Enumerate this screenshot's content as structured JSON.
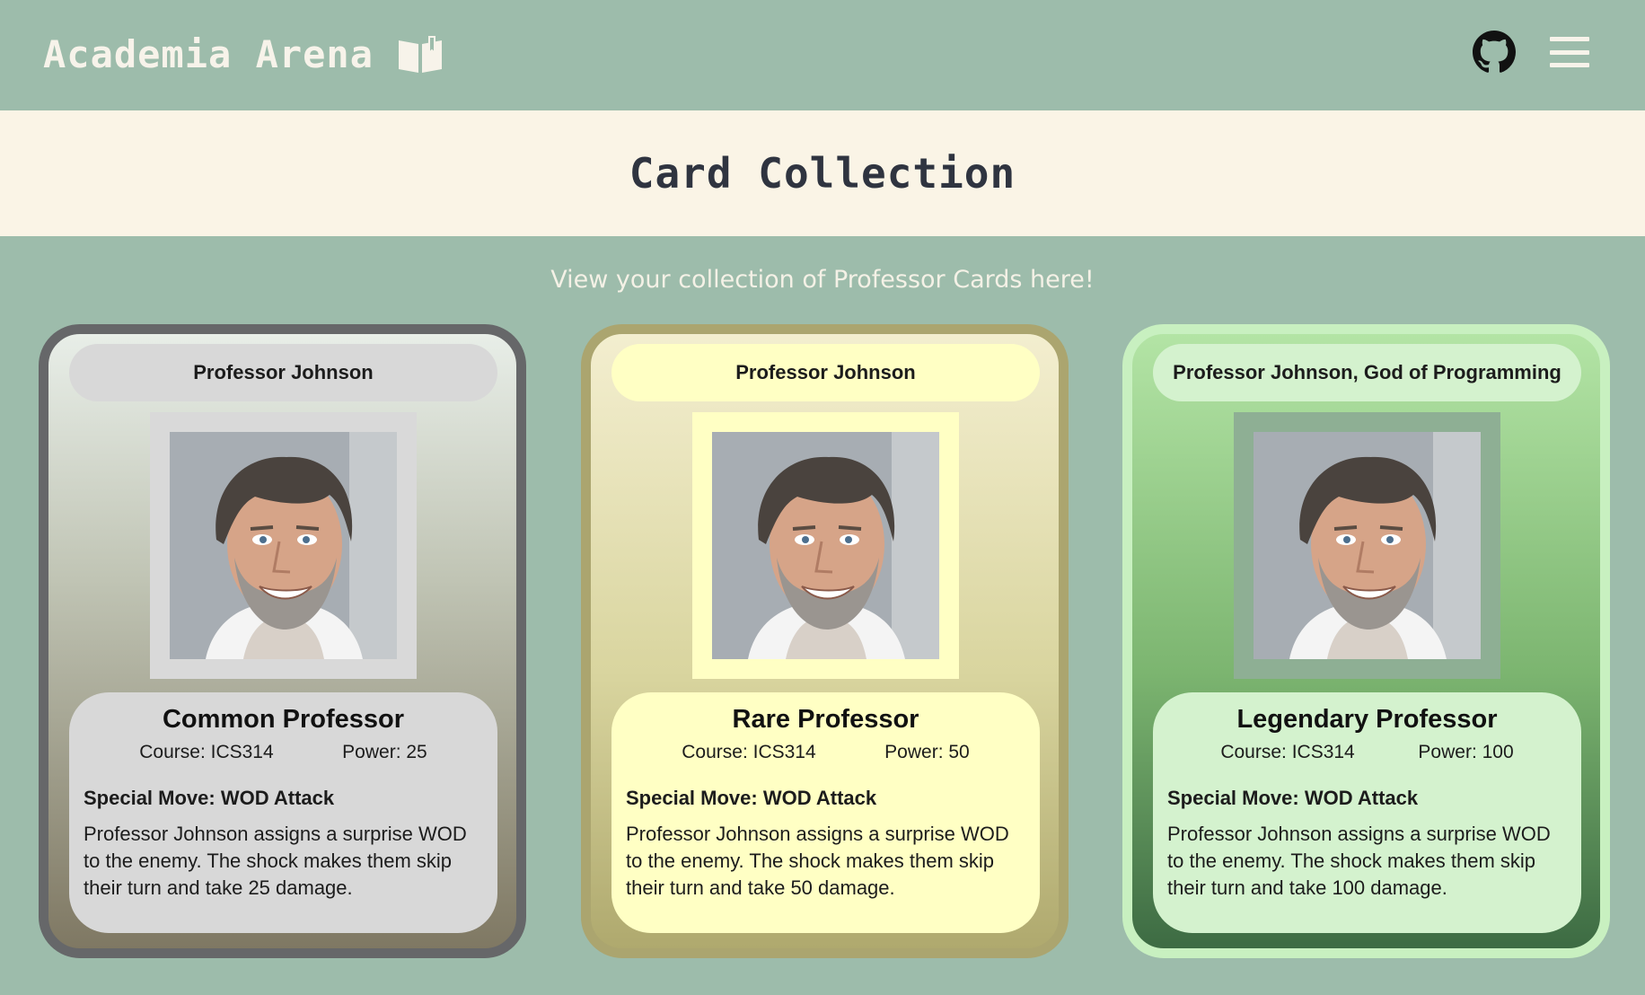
{
  "navbar": {
    "brand": "Academia Arena",
    "icons": [
      "book-icon",
      "github-icon",
      "menu-icon"
    ]
  },
  "banner": {
    "title": "Card Collection"
  },
  "subtitle": "View your collection of Professor Cards here!",
  "cards": [
    {
      "name": "Professor Johnson",
      "rarity": "Common Professor",
      "course": "Course: ICS314",
      "power": "Power: 25",
      "special_move": "Special Move: WOD Attack",
      "description": "Professor Johnson assigns a surprise WOD to the enemy. The shock makes them skip their turn and take 25 damage."
    },
    {
      "name": "Professor Johnson",
      "rarity": "Rare Professor",
      "course": "Course: ICS314",
      "power": "Power: 50",
      "special_move": "Special Move: WOD Attack",
      "description": "Professor Johnson assigns a surprise WOD to the enemy. The shock makes them skip their turn and take 50 damage."
    },
    {
      "name": "Professor Johnson, God of Programming",
      "rarity": "Legendary Professor",
      "course": "Course: ICS314",
      "power": "Power: 100",
      "special_move": "Special Move: WOD Attack",
      "description": "Professor Johnson assigns a surprise WOD to the enemy. The shock makes them skip their turn and take 100 damage."
    }
  ],
  "colors": {
    "page_bg": "#9dbcab",
    "banner_bg": "#faf4e6",
    "common_border": "#666769",
    "rare_border": "#aba56f",
    "legendary_border": "#c8f0c0"
  }
}
